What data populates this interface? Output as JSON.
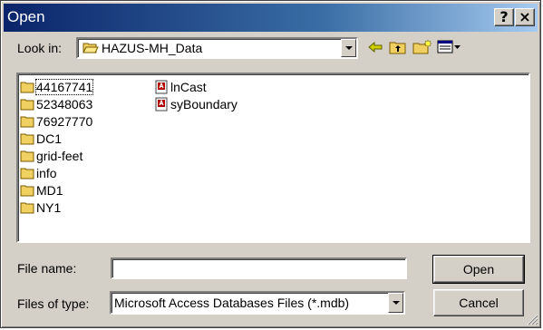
{
  "window": {
    "title": "Open",
    "help_label": "?",
    "close_label": "×"
  },
  "lookin": {
    "label": "Look in:",
    "value": "HAZUS-MH_Data"
  },
  "files": {
    "column1": [
      {
        "name": "44167741",
        "type": "folder",
        "selected": true
      },
      {
        "name": "52348063",
        "type": "folder"
      },
      {
        "name": "76927770",
        "type": "folder"
      },
      {
        "name": "DC1",
        "type": "folder"
      },
      {
        "name": "grid-feet",
        "type": "folder"
      },
      {
        "name": "info",
        "type": "folder"
      },
      {
        "name": "MD1",
        "type": "folder"
      },
      {
        "name": "NY1",
        "type": "folder"
      }
    ],
    "column2": [
      {
        "name": "lnCast",
        "type": "mdb"
      },
      {
        "name": "syBoundary",
        "type": "mdb"
      }
    ]
  },
  "filename": {
    "label": "File name:",
    "value": ""
  },
  "filetype": {
    "label": "Files of type:",
    "value": "Microsoft Access Databases Files (*.mdb)"
  },
  "buttons": {
    "open": "Open",
    "cancel": "Cancel"
  },
  "toolbar": {
    "icons": [
      "back-arrow-icon",
      "up-one-level-icon",
      "new-folder-icon",
      "view-menu-icon"
    ]
  },
  "colors": {
    "title_start": "#0a246a",
    "title_end": "#a6caf0",
    "face": "#d4d0c8",
    "folder": "#f0d060"
  }
}
